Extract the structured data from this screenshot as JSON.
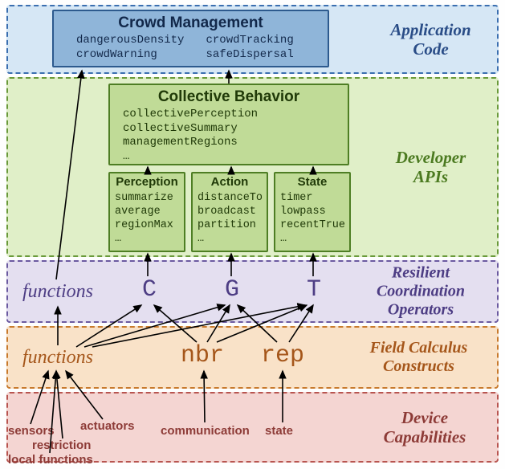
{
  "layers": {
    "app": "Application\nCode",
    "dev": "Developer\nAPIs",
    "res": "Resilient\nCoordination\nOperators",
    "fc": "Field Calculus\nConstructs",
    "dc": "Device\nCapabilities"
  },
  "crowd_management": {
    "title": "Crowd Management",
    "items": "dangerousDensity\ncrowdWarning\ncrowdTracking\nsafeDispersal"
  },
  "collective_behavior": {
    "title": "Collective Behavior",
    "items": "collectivePerception\ncollectiveSummary\nmanagementRegions\n…"
  },
  "perception": {
    "title": "Perception",
    "items": "summarize\naverage\nregionMax\n…"
  },
  "action": {
    "title": "Action",
    "items": "distanceTo\nbroadcast\npartition\n…"
  },
  "state": {
    "title": "State",
    "items": "timer\nlowpass\nrecentTrue\n…"
  },
  "ops": {
    "functions1": "functions",
    "C": "C",
    "G": "G",
    "T": "T",
    "functions2": "functions",
    "nbr": "nbr",
    "rep": "rep"
  },
  "device": {
    "sensors": "sensors",
    "actuators": "actuators",
    "restriction": "restriction",
    "local_functions": "local functions",
    "communication": "communication",
    "state": "state"
  },
  "chart_data": {
    "type": "diagram-layered",
    "layers_top_to_bottom": [
      "Application Code",
      "Developer APIs",
      "Resilient Coordination Operators",
      "Field Calculus Constructs",
      "Device Capabilities"
    ],
    "nodes": {
      "Crowd Management": {
        "layer": "Application Code",
        "members": [
          "dangerousDensity",
          "crowdWarning",
          "crowdTracking",
          "safeDispersal"
        ]
      },
      "Collective Behavior": {
        "layer": "Developer APIs",
        "members": [
          "collectivePerception",
          "collectiveSummary",
          "managementRegions",
          "…"
        ]
      },
      "Perception": {
        "layer": "Developer APIs",
        "members": [
          "summarize",
          "average",
          "regionMax",
          "…"
        ]
      },
      "Action": {
        "layer": "Developer APIs",
        "members": [
          "distanceTo",
          "broadcast",
          "partition",
          "…"
        ]
      },
      "State": {
        "layer": "Developer APIs",
        "members": [
          "timer",
          "lowpass",
          "recentTrue",
          "…"
        ]
      },
      "functions_res": {
        "layer": "Resilient Coordination Operators",
        "label": "functions"
      },
      "C": {
        "layer": "Resilient Coordination Operators"
      },
      "G": {
        "layer": "Resilient Coordination Operators"
      },
      "T": {
        "layer": "Resilient Coordination Operators"
      },
      "functions_fc": {
        "layer": "Field Calculus Constructs",
        "label": "functions"
      },
      "nbr": {
        "layer": "Field Calculus Constructs"
      },
      "rep": {
        "layer": "Field Calculus Constructs"
      },
      "sensors": {
        "layer": "Device Capabilities"
      },
      "actuators": {
        "layer": "Device Capabilities"
      },
      "restriction": {
        "layer": "Device Capabilities"
      },
      "local functions": {
        "layer": "Device Capabilities"
      },
      "communication": {
        "layer": "Device Capabilities"
      },
      "state": {
        "layer": "Device Capabilities"
      }
    },
    "edges_upward": [
      [
        "sensors",
        "functions_fc"
      ],
      [
        "actuators",
        "functions_fc"
      ],
      [
        "restriction",
        "functions_fc"
      ],
      [
        "local functions",
        "functions_fc"
      ],
      [
        "communication",
        "nbr"
      ],
      [
        "state",
        "rep"
      ],
      [
        "functions_fc",
        "functions_res"
      ],
      [
        "functions_fc",
        "C"
      ],
      [
        "functions_fc",
        "G"
      ],
      [
        "functions_fc",
        "T"
      ],
      [
        "nbr",
        "C"
      ],
      [
        "nbr",
        "G"
      ],
      [
        "nbr",
        "T"
      ],
      [
        "rep",
        "G"
      ],
      [
        "rep",
        "T"
      ],
      [
        "functions_res",
        "Crowd Management"
      ],
      [
        "C",
        "Perception"
      ],
      [
        "G",
        "Action"
      ],
      [
        "T",
        "State"
      ],
      [
        "Perception",
        "Collective Behavior"
      ],
      [
        "Action",
        "Collective Behavior"
      ],
      [
        "State",
        "Collective Behavior"
      ],
      [
        "Collective Behavior",
        "Crowd Management"
      ]
    ]
  }
}
